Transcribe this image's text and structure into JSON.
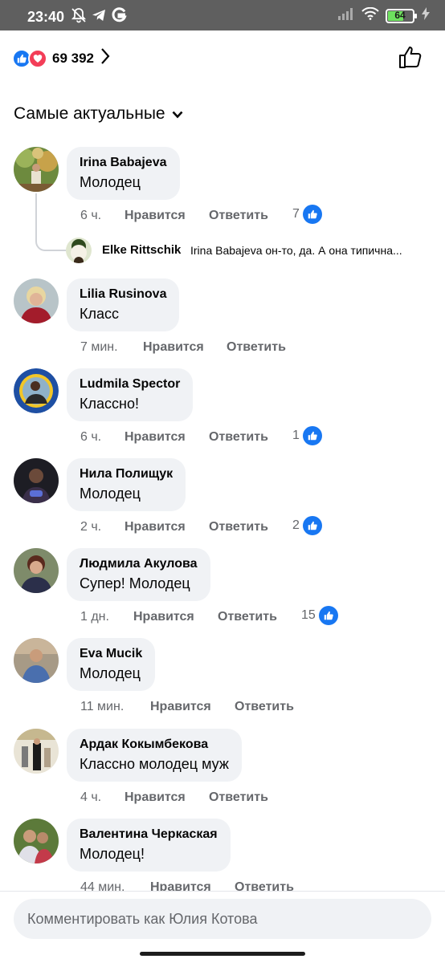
{
  "status": {
    "time": "23:40",
    "battery": "64",
    "battery_level": 0.64,
    "icons": [
      "mute-bell-icon",
      "telegram-icon",
      "google-icon",
      "signal-icon",
      "wifi-icon",
      "battery-icon",
      "charging-icon"
    ]
  },
  "reactions": {
    "count": "69 392",
    "types": [
      "like",
      "love"
    ]
  },
  "sort": {
    "label": "Самые актуальные"
  },
  "comments": [
    {
      "author": "Irina Babajeva",
      "text": "Молодец",
      "time": "6 ч.",
      "like": "Нравится",
      "reply": "Ответить",
      "likes": "7"
    },
    {
      "author": "Lilia Rusinova",
      "text": "Класс",
      "time": "7 мин.",
      "like": "Нравится",
      "reply": "Ответить",
      "likes": ""
    },
    {
      "author": "Ludmila Spector",
      "text": "Классно!",
      "time": "6 ч.",
      "like": "Нравится",
      "reply": "Ответить",
      "likes": "1"
    },
    {
      "author": "Нила Полищук",
      "text": "Молодец",
      "time": "2 ч.",
      "like": "Нравится",
      "reply": "Ответить",
      "likes": "2"
    },
    {
      "author": "Людмила Акулова",
      "text": "Супер! Молодец",
      "time": "1 дн.",
      "like": "Нравится",
      "reply": "Ответить",
      "likes": "15"
    },
    {
      "author": "Eva Mucik",
      "text": "Молодец",
      "time": "11 мин.",
      "like": "Нравится",
      "reply": "Ответить",
      "likes": ""
    },
    {
      "author": "Ардак Кокымбекова",
      "text": "Классно молодец муж",
      "time": "4 ч.",
      "like": "Нравится",
      "reply": "Ответить",
      "likes": ""
    },
    {
      "author": "Валентина Черкаская",
      "text": "Молодец!",
      "time": "44 мин.",
      "like": "Нравится",
      "reply": "Ответить",
      "likes": ""
    }
  ],
  "reply": {
    "author": "Elke Rittschik",
    "text": "Irina Babajeva он-то, да. А она типична..."
  },
  "composer": {
    "placeholder": "Комментировать как Юлия Котова"
  },
  "colors": {
    "accent": "#1877f2",
    "love": "#f33e58",
    "bubble": "#f0f2f5",
    "meta": "#65676b"
  }
}
